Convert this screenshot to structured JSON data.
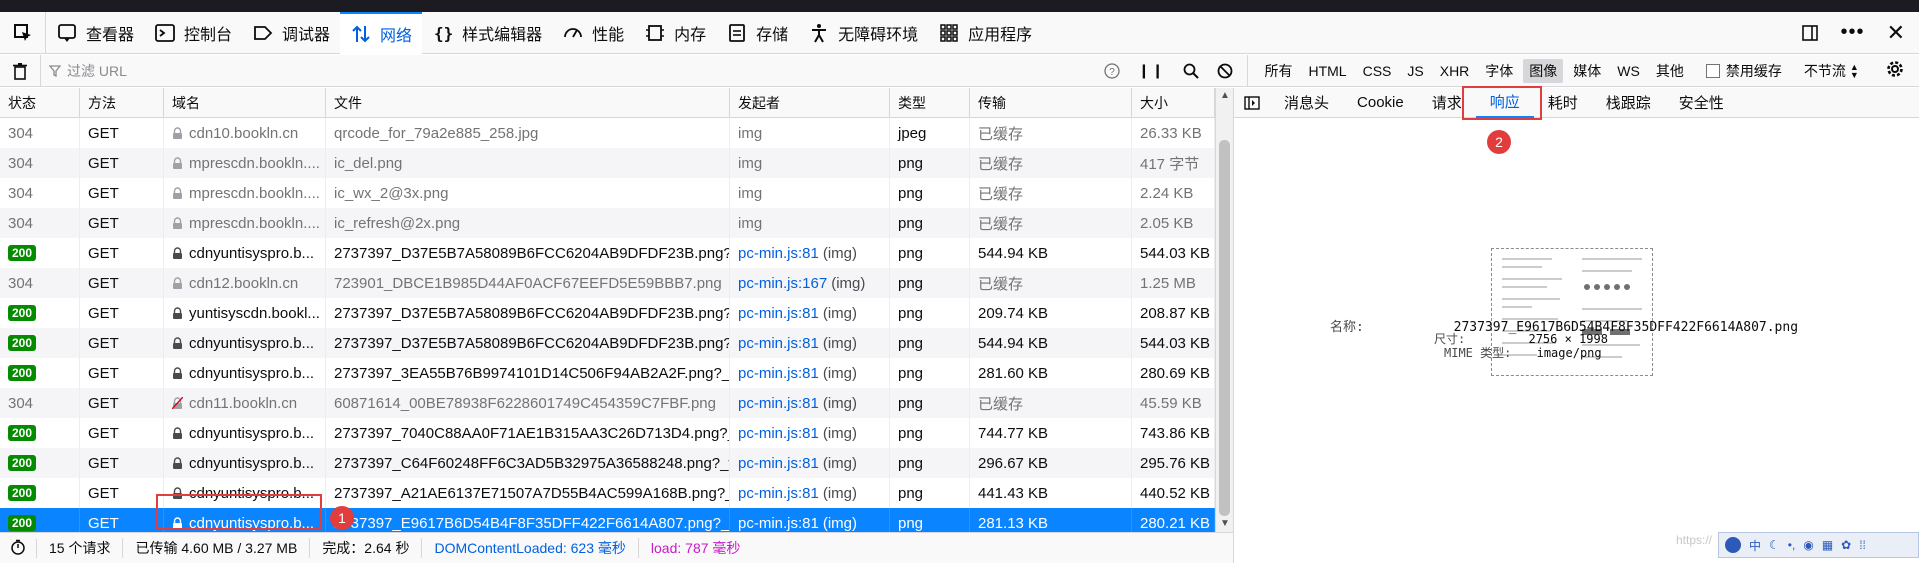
{
  "toolbox": {
    "tabs": [
      {
        "label": "查看器",
        "icon": "inspector-icon"
      },
      {
        "label": "控制台",
        "icon": "console-icon"
      },
      {
        "label": "调试器",
        "icon": "debugger-icon"
      },
      {
        "label": "网络",
        "icon": "network-icon",
        "selected": true
      },
      {
        "label": "样式编辑器",
        "icon": "style-editor-icon"
      },
      {
        "label": "性能",
        "icon": "performance-icon"
      },
      {
        "label": "内存",
        "icon": "memory-icon"
      },
      {
        "label": "存储",
        "icon": "storage-icon"
      },
      {
        "label": "无障碍环境",
        "icon": "accessibility-icon"
      },
      {
        "label": "应用程序",
        "icon": "application-icon"
      }
    ]
  },
  "toolbar": {
    "filter_placeholder": "过滤 URL",
    "types": [
      "所有",
      "HTML",
      "CSS",
      "JS",
      "XHR",
      "字体",
      "图像",
      "媒体",
      "WS",
      "其他"
    ],
    "active_type": "图像",
    "disable_cache": "禁用缓存",
    "throttle": "不节流"
  },
  "table": {
    "columns": [
      "状态",
      "方法",
      "域名",
      "文件",
      "发起者",
      "类型",
      "传输",
      "大小"
    ],
    "rows": [
      {
        "status": "304",
        "method": "GET",
        "domain": "cdn10.bookln.cn",
        "file": "qrcode_for_79a2e885_258.jpg",
        "initiator": "img",
        "initiator_sub": "",
        "type": "jpeg",
        "transfer": "已缓存",
        "size": "26.33 KB",
        "lock": "gray"
      },
      {
        "status": "304",
        "method": "GET",
        "domain": "mprescdn.bookln....",
        "file": "ic_del.png",
        "initiator": "img",
        "initiator_sub": "",
        "type": "png",
        "transfer": "已缓存",
        "size": "417 字节",
        "lock": "gray"
      },
      {
        "status": "304",
        "method": "GET",
        "domain": "mprescdn.bookln....",
        "file": "ic_wx_2@3x.png",
        "initiator": "img",
        "initiator_sub": "",
        "type": "png",
        "transfer": "已缓存",
        "size": "2.24 KB",
        "lock": "gray"
      },
      {
        "status": "304",
        "method": "GET",
        "domain": "mprescdn.bookln....",
        "file": "ic_refresh@2x.png",
        "initiator": "img",
        "initiator_sub": "",
        "type": "png",
        "transfer": "已缓存",
        "size": "2.05 KB",
        "lock": "gray"
      },
      {
        "status": "200",
        "method": "GET",
        "domain": "cdnyuntisyspro.b...",
        "file": "2737397_D37E5B7A58089B6FCC6204AB9DFDF23B.png?_wid",
        "initiator": "pc-min.js:81",
        "initiator_sub": "(img)",
        "type": "png",
        "transfer": "544.94 KB",
        "size": "544.03 KB",
        "lock": "dark"
      },
      {
        "status": "304",
        "method": "GET",
        "domain": "cdn12.bookln.cn",
        "file": "723901_DBCE1B985D44AF0ACF67EEFD5E59BBB7.png",
        "initiator": "pc-min.js:167",
        "initiator_sub": "(img)",
        "type": "png",
        "transfer": "已缓存",
        "size": "1.25 MB",
        "lock": "gray"
      },
      {
        "status": "200",
        "method": "GET",
        "domain": "yuntisyscdn.bookl...",
        "file": "2737397_D37E5B7A58089B6FCC6204AB9DFDF23B.png?_wid",
        "initiator": "pc-min.js:81",
        "initiator_sub": "(img)",
        "type": "png",
        "transfer": "209.74 KB",
        "size": "208.87 KB",
        "lock": "dark"
      },
      {
        "status": "200",
        "method": "GET",
        "domain": "cdnyuntisyspro.b...",
        "file": "2737397_D37E5B7A58089B6FCC6204AB9DFDF23B.png?_wid",
        "initiator": "pc-min.js:81",
        "initiator_sub": "(img)",
        "type": "png",
        "transfer": "544.94 KB",
        "size": "544.03 KB",
        "lock": "dark"
      },
      {
        "status": "200",
        "method": "GET",
        "domain": "cdnyuntisyspro.b...",
        "file": "2737397_3EA55B76B9974101D14C506F94AB2A2F.png?_widt",
        "initiator": "pc-min.js:81",
        "initiator_sub": "(img)",
        "type": "png",
        "transfer": "281.60 KB",
        "size": "280.69 KB",
        "lock": "dark"
      },
      {
        "status": "304",
        "method": "GET",
        "domain": "cdn11.bookln.cn",
        "file": "60871614_00BE78938F6228601749C454359C7FBF.png",
        "initiator": "pc-min.js:81",
        "initiator_sub": "(img)",
        "type": "png",
        "transfer": "已缓存",
        "size": "45.59 KB",
        "lock": "broken"
      },
      {
        "status": "200",
        "method": "GET",
        "domain": "cdnyuntisyspro.b...",
        "file": "2737397_7040C88AA0F71AE1B315AA3C26D713D4.png?_wic",
        "initiator": "pc-min.js:81",
        "initiator_sub": "(img)",
        "type": "png",
        "transfer": "744.77 KB",
        "size": "743.86 KB",
        "lock": "dark"
      },
      {
        "status": "200",
        "method": "GET",
        "domain": "cdnyuntisyspro.b...",
        "file": "2737397_C64F60248FF6C3AD5B32975A36588248.png?_widt",
        "initiator": "pc-min.js:81",
        "initiator_sub": "(img)",
        "type": "png",
        "transfer": "296.67 KB",
        "size": "295.76 KB",
        "lock": "dark"
      },
      {
        "status": "200",
        "method": "GET",
        "domain": "cdnyuntisyspro.b...",
        "file": "2737397_A21AE6137E71507A7D55B4AC599A168B.png?_widt",
        "initiator": "pc-min.js:81",
        "initiator_sub": "(img)",
        "type": "png",
        "transfer": "441.43 KB",
        "size": "440.52 KB",
        "lock": "dark"
      },
      {
        "status": "200",
        "method": "GET",
        "domain": "cdnyuntisyspro.b...",
        "file": "2737397_E9617B6D54B4F8F35DFF422F6614A807.png?_widt",
        "initiator": "pc-min.js:81",
        "initiator_sub": "(img)",
        "type": "png",
        "transfer": "281.13 KB",
        "size": "280.21 KB",
        "lock": "white",
        "selected": true
      }
    ]
  },
  "status": {
    "requests": "15 个请求",
    "transferred": "已传输 4.60 MB / 3.27 MB",
    "finish": "完成：2.64 秒",
    "dcl": "DOMContentLoaded: 623 毫秒",
    "load": "load: 787 毫秒"
  },
  "side": {
    "tabs": [
      "消息头",
      "Cookie",
      "请求",
      "响应",
      "耗时",
      "栈跟踪",
      "安全性"
    ],
    "active_tab": "响应",
    "name_label": "名称:",
    "name_value": "2737397_E9617B6D54B4F8F35DFF422F6614A807.png",
    "dim_label": "尺寸:",
    "dim_value": "2756 × 1998",
    "mime_label": "MIME 类型:",
    "mime_value": "image/png"
  },
  "annotations": {
    "mark1": "1",
    "mark2": "2"
  },
  "watermark": "https://",
  "colors": {
    "accent": "#0a84ff",
    "ok": "#058b00",
    "mark": "#e13d3d"
  }
}
